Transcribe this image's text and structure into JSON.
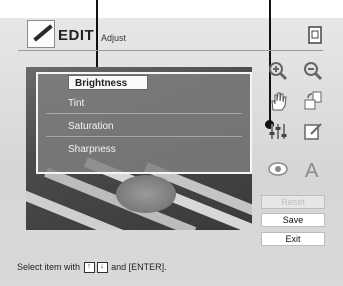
{
  "header": {
    "title": "EDIT",
    "subtitle": "Adjust",
    "icon": "pencil-icon"
  },
  "adjust_menu": {
    "items": [
      {
        "label": "Brightness",
        "selected": true
      },
      {
        "label": "Tint",
        "selected": false
      },
      {
        "label": "Saturation",
        "selected": false
      },
      {
        "label": "Sharpness",
        "selected": false
      }
    ]
  },
  "toolbar": {
    "icons": [
      "page-icon",
      "zoom-in-icon",
      "zoom-out-icon",
      "hand-icon",
      "rotate-icon",
      "adjust-icon",
      "edit-frame-icon",
      "red-eye-icon",
      "text-icon"
    ],
    "text_icon_label": "A"
  },
  "buttons": {
    "reset": "Reset",
    "save": "Save",
    "exit": "Exit"
  },
  "status": {
    "prefix": "Select item with",
    "key_up": "↑",
    "key_down": "↓",
    "suffix": "and [ENTER]."
  }
}
